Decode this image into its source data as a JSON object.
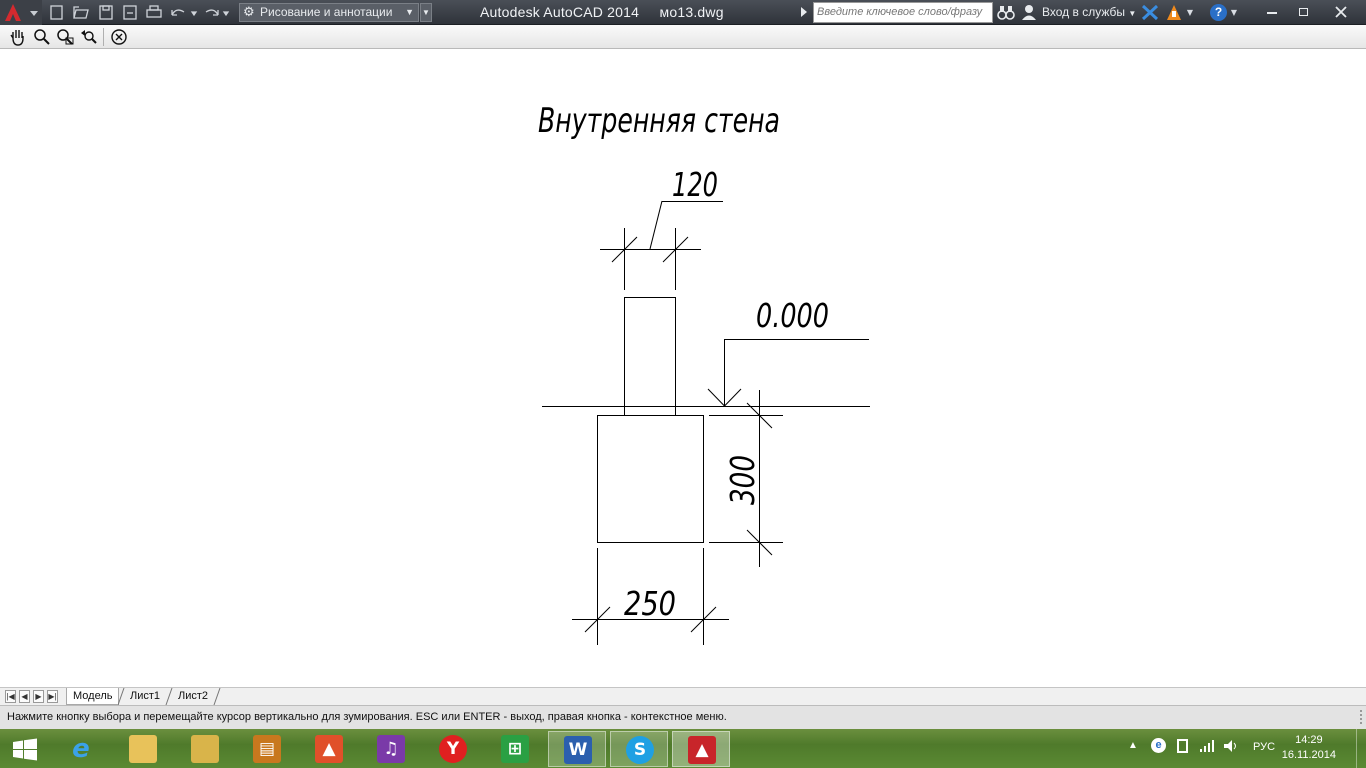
{
  "app": {
    "window_title": "Autodesk AutoCAD 2014     мо13.dwg",
    "workspace": "Рисование и аннотации",
    "search_placeholder": "Введите ключевое слово/фразу",
    "signin_label": "Вход в службы"
  },
  "drawing": {
    "title": "Внутренняя стена",
    "dim_top": "120",
    "elevation": "0.000",
    "dim_right": "300",
    "dim_bottom": "250"
  },
  "layout_tabs": [
    "Модель",
    "Лист1",
    "Лист2"
  ],
  "status": {
    "message": "Нажмите кнопку выбора и перемещайте курсор вертикально для зумирования. ESC или ENTER - выход, правая кнопка - контекстное меню."
  },
  "taskbar": {
    "apps": [
      "start-icon",
      "internet-explorer-icon",
      "file-explorer-icon",
      "folder-app-icon",
      "notes-app-icon",
      "photos-icon",
      "video-icon",
      "yandex-browser-icon",
      "store-icon",
      "word-icon",
      "skype-icon",
      "autocad-icon"
    ],
    "lang": "РУС",
    "time": "14:29",
    "date": "16.11.2014"
  },
  "colors": {
    "titlebar": "#3a3e45",
    "autocad_red": "#c8252a",
    "drawing_bg": "#ffffff",
    "line": "#000000"
  }
}
